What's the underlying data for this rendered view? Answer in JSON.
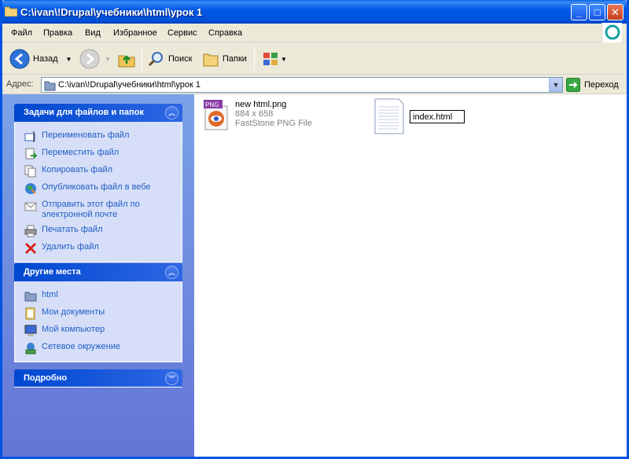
{
  "window": {
    "title": "C:\\ivan\\!Drupal\\учебники\\html\\урок 1"
  },
  "menu": [
    "Файл",
    "Правка",
    "Вид",
    "Избранное",
    "Сервис",
    "Справка"
  ],
  "toolbar": {
    "back": "Назад",
    "search": "Поиск",
    "folders": "Папки"
  },
  "address": {
    "label": "Адрес:",
    "value": "C:\\ivan\\!Drupal\\учебники\\html\\урок 1",
    "go": "Переход"
  },
  "tasks_panel": {
    "title": "Задачи для файлов и папок",
    "items": [
      {
        "label": "Переименовать файл",
        "icon": "rename-icon"
      },
      {
        "label": "Переместить файл",
        "icon": "move-icon"
      },
      {
        "label": "Копировать файл",
        "icon": "copy-icon"
      },
      {
        "label": "Опубликовать файл в вебе",
        "icon": "publish-web-icon"
      },
      {
        "label": "Отправить этот файл по электронной почте",
        "icon": "email-icon"
      },
      {
        "label": "Печатать файл",
        "icon": "print-icon"
      },
      {
        "label": "Удалить файл",
        "icon": "delete-icon"
      }
    ]
  },
  "places_panel": {
    "title": "Другие места",
    "items": [
      {
        "label": "html",
        "icon": "folder-icon"
      },
      {
        "label": "Мои документы",
        "icon": "my-documents-icon"
      },
      {
        "label": "Мой компьютер",
        "icon": "my-computer-icon"
      },
      {
        "label": "Сетевое окружение",
        "icon": "network-icon"
      }
    ]
  },
  "details_panel": {
    "title": "Подробно"
  },
  "files": [
    {
      "name": "new html.png",
      "size": "884 x 658",
      "type": "FastStone PNG File",
      "badge": "PNG"
    },
    {
      "rename_value": "index.html"
    }
  ]
}
